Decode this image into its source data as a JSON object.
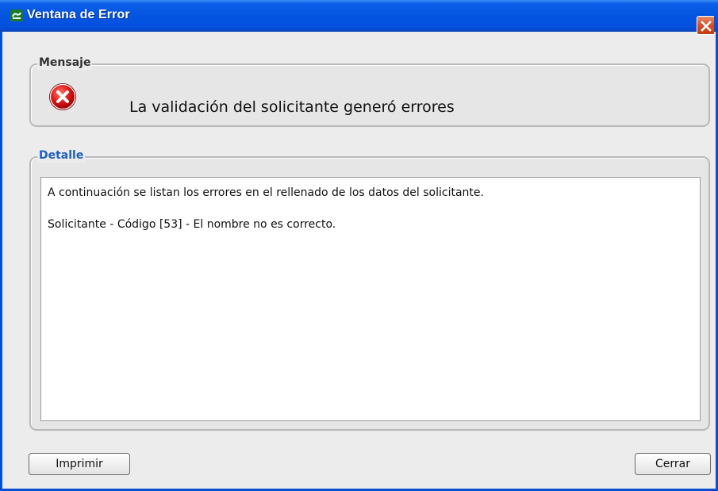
{
  "window": {
    "title": "Ventana de Error",
    "icon": "app-icon",
    "close_icon": "close-icon"
  },
  "message_group": {
    "label": "Mensaje",
    "icon": "error-icon",
    "text": "La validación del solicitante generó errores"
  },
  "detail_group": {
    "label": "Detalle",
    "lines": [
      "A continuación se listan los errores en el rellenado de los datos del solicitante.",
      "Solicitante - Código [53] - El nombre no es correcto."
    ]
  },
  "buttons": {
    "print_label": "Imprimir",
    "close_label": "Cerrar"
  },
  "colors": {
    "titlebar": "#0454e0",
    "detail_label": "#1f5fbf",
    "error_red": "#e21a1a"
  }
}
